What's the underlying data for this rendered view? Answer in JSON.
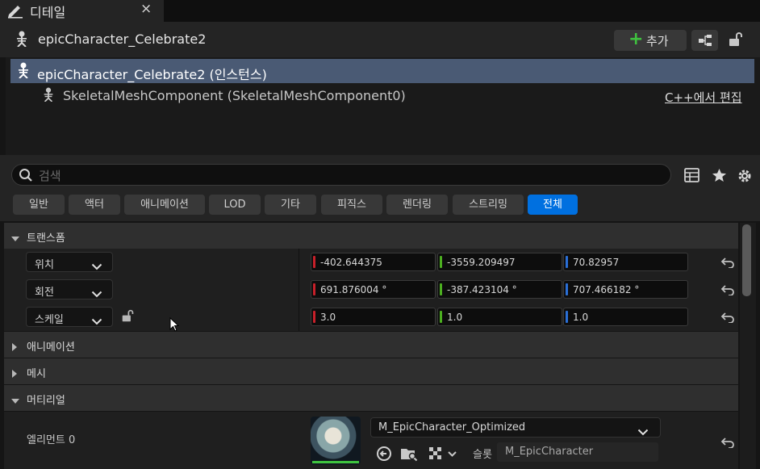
{
  "tab": {
    "title": "디테일",
    "close": "×"
  },
  "header": {
    "actor_name": "epicCharacter_Celebrate2",
    "add_label": "추가",
    "add_plus": "+"
  },
  "tree": {
    "rows": [
      {
        "label": "epicCharacter_Celebrate2 (인스턴스)"
      },
      {
        "label": "SkeletalMeshComponent (SkeletalMeshComponent0)"
      }
    ],
    "cpp_link": "C++에서 편집"
  },
  "search": {
    "placeholder": "검색"
  },
  "filters": [
    "일반",
    "액터",
    "애니메이션",
    "LOD",
    "기타",
    "피직스",
    "렌더링",
    "스트리밍",
    "전체"
  ],
  "active_filter": "전체",
  "categories": {
    "transform": "트랜스폼",
    "animation": "애니메이션",
    "mesh": "메시",
    "material": "머티리얼"
  },
  "transform": {
    "location": {
      "label": "위치",
      "x": "-402.644375",
      "y": "-3559.209497",
      "z": "70.82957"
    },
    "rotation": {
      "label": "회전",
      "x": "691.876004 °",
      "y": "-387.423104 °",
      "z": "707.466182 °"
    },
    "scale": {
      "label": "스케일",
      "x": "3.0",
      "y": "1.0",
      "z": "1.0"
    }
  },
  "material": {
    "element_label": "엘리먼트 0",
    "material_name": "M_EpicCharacter_Optimized",
    "slot_label": "슬롯",
    "slot_value": "M_EpicCharacter"
  },
  "colors": {
    "axis_x": "#c8202a",
    "axis_y": "#4caf20",
    "axis_z": "#2a6fd6",
    "accent": "#0070e0",
    "add_green": "#3fc33f"
  }
}
